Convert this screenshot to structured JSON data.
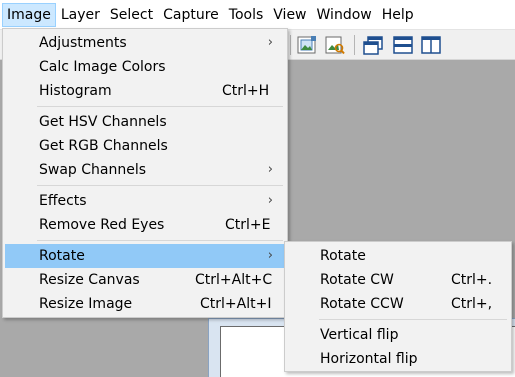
{
  "menubar": {
    "items": [
      "Image",
      "Layer",
      "Select",
      "Capture",
      "Tools",
      "View",
      "Window",
      "Help"
    ]
  },
  "image_menu": {
    "items": [
      {
        "label": "Adjustments",
        "submenu": true
      },
      {
        "label": "Calc Image Colors"
      },
      {
        "label": "Histogram",
        "shortcut": "Ctrl+H"
      },
      {
        "label": "Get HSV Channels"
      },
      {
        "label": "Get RGB Channels"
      },
      {
        "label": "Swap Channels",
        "submenu": true
      },
      {
        "label": "Effects",
        "submenu": true
      },
      {
        "label": "Remove Red Eyes",
        "shortcut": "Ctrl+E"
      },
      {
        "label": "Rotate",
        "submenu": true,
        "highlighted": true
      },
      {
        "label": "Resize Canvas",
        "shortcut": "Ctrl+Alt+C"
      },
      {
        "label": "Resize Image",
        "shortcut": "Ctrl+Alt+I"
      }
    ]
  },
  "rotate_submenu": {
    "items": [
      {
        "label": "Rotate"
      },
      {
        "label": "Rotate CW",
        "shortcut": "Ctrl+."
      },
      {
        "label": "Rotate CCW",
        "shortcut": "Ctrl+,"
      },
      {
        "label": "Vertical flip"
      },
      {
        "label": "Horizontal flip"
      }
    ]
  },
  "toolbar": {
    "icons": [
      "image-frame-icon",
      "image-search-icon",
      "cascade-windows-icon",
      "tile-horizontal-icon",
      "tile-vertical-icon"
    ]
  },
  "colors": {
    "menu_highlight": "#91c9f7",
    "menubar_active": "#cce8ff",
    "workspace": "#a9a9a9"
  }
}
